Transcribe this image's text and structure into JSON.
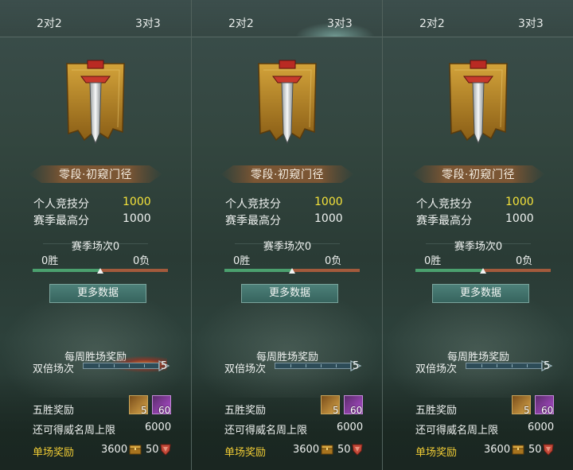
{
  "panels": [
    {
      "tabs": [
        "2对2",
        "3对3"
      ],
      "active_tab": "none",
      "rank_name": "零段·初窥门径",
      "personal_score_label": "个人竞技分",
      "personal_score": "1000",
      "season_high_label": "赛季最高分",
      "season_high": "1000",
      "season_matches": "赛季场次0",
      "wins": "0胜",
      "losses": "0负",
      "win_ratio": 0.5,
      "more_button": "更多数据",
      "weekly_title": "每周胜场奖励",
      "double_label": "双倍场次",
      "double_count": "5",
      "double_flame": true,
      "five_win_label": "五胜奖励",
      "five_win_items": [
        {
          "icon": "gold-chest-icon",
          "count": "5"
        },
        {
          "icon": "purple-gem-icon",
          "count": "60"
        }
      ],
      "remain_label": "还可得威名周上限",
      "remain_value": "6000",
      "single_label": "单场奖励",
      "single_value1": "3600",
      "single_value2": "50"
    },
    {
      "tabs": [
        "2对2",
        "3对3"
      ],
      "active_tab": "3对3",
      "rank_name": "零段·初窥门径",
      "personal_score_label": "个人竞技分",
      "personal_score": "1000",
      "season_high_label": "赛季最高分",
      "season_high": "1000",
      "season_matches": "赛季场次0",
      "wins": "0胜",
      "losses": "0负",
      "win_ratio": 0.5,
      "more_button": "更多数据",
      "weekly_title": "每周胜场奖励",
      "double_label": "双倍场次",
      "double_count": "5",
      "double_flame": false,
      "five_win_label": "五胜奖励",
      "five_win_items": [
        {
          "icon": "gold-chest-icon",
          "count": "5"
        },
        {
          "icon": "purple-gem-icon",
          "count": "60"
        }
      ],
      "remain_label": "还可得威名周上限",
      "remain_value": "6000",
      "single_label": "单场奖励",
      "single_value1": "3600",
      "single_value2": "50"
    },
    {
      "tabs": [
        "2对2",
        "3对3"
      ],
      "active_tab": "none",
      "rank_name": "零段·初窥门径",
      "personal_score_label": "个人竞技分",
      "personal_score": "1000",
      "season_high_label": "赛季最高分",
      "season_high": "1000",
      "season_matches": "赛季场次0",
      "wins": "0胜",
      "losses": "0负",
      "win_ratio": 0.5,
      "more_button": "更多数据",
      "weekly_title": "每周胜场奖励",
      "double_label": "双倍场次",
      "double_count": "5",
      "double_flame": false,
      "five_win_label": "五胜奖励",
      "five_win_items": [
        {
          "icon": "gold-chest-icon",
          "count": "5"
        },
        {
          "icon": "purple-gem-icon",
          "count": "60"
        }
      ],
      "remain_label": "还可得威名周上限",
      "remain_value": "6000",
      "single_label": "单场奖励",
      "single_value1": "3600",
      "single_value2": "50"
    }
  ],
  "colors": {
    "score_gold": "#f4e23a",
    "single_label_gold": "#f0cc35",
    "win_green": "#4ba06e",
    "loss_orange": "#a35a3c",
    "banner_gold": "#b8862a"
  }
}
